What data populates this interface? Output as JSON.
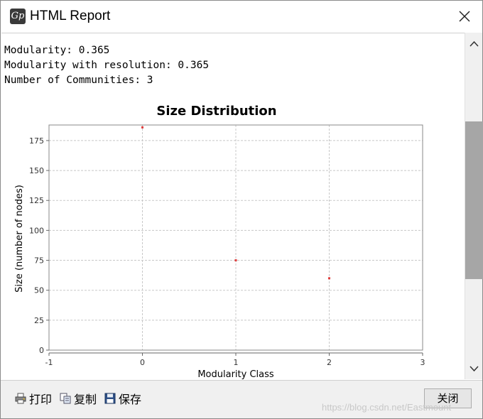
{
  "window": {
    "title": "HTML Report",
    "icon": "app-logo-icon"
  },
  "stats": {
    "line1": "Modularity: 0.365",
    "line2": "Modularity with resolution: 0.365",
    "line3": "Number of Communities: 3"
  },
  "chart_data": {
    "type": "scatter",
    "title": "Size Distribution",
    "xlabel": "Modularity Class",
    "ylabel": "Size (number of nodes)",
    "xlim": [
      -1,
      3
    ],
    "ylim": [
      0,
      188
    ],
    "x_ticks": [
      "-1",
      "0",
      "1",
      "2",
      "3"
    ],
    "y_ticks": [
      "0",
      "25",
      "50",
      "75",
      "100",
      "125",
      "150",
      "175"
    ],
    "x": [
      0,
      1,
      2
    ],
    "y": [
      186,
      75,
      60
    ],
    "point_color": "#e03c3c",
    "grid": true
  },
  "toolbar": {
    "print_label": "打印",
    "copy_label": "复制",
    "save_label": "保存",
    "close_label": "关闭"
  },
  "watermark": "https://blog.csdn.net/Eastmount"
}
